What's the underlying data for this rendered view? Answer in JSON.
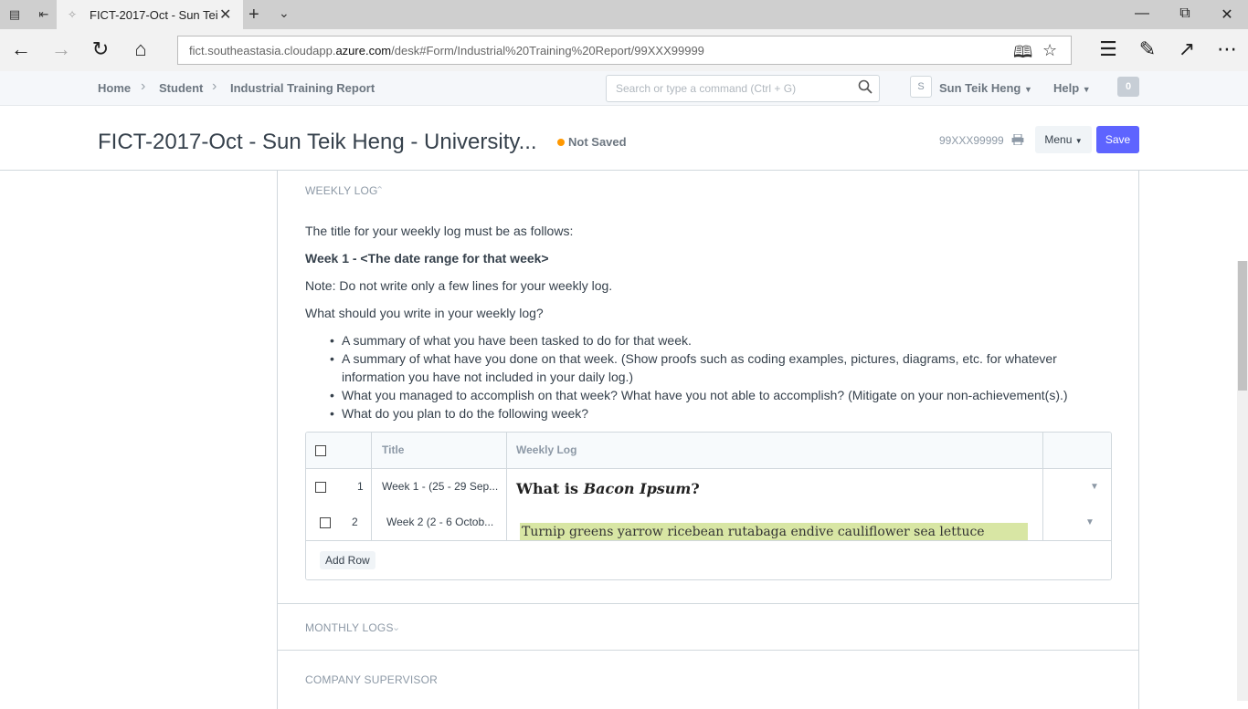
{
  "browser": {
    "tab_title": "FICT-2017-Oct - Sun Tei",
    "url_prefix": "fict.southeastasia.cloudapp.",
    "url_domain": "azure.com",
    "url_path": "/desk#Form/Industrial%20Training%20Report/99XXX99999"
  },
  "appbar": {
    "breadcrumbs": [
      "Home",
      "Student",
      "Industrial Training Report"
    ],
    "search_placeholder": "Search or type a command (Ctrl + G)",
    "avatar_initial": "S",
    "user_name": "Sun Teik Heng",
    "help_label": "Help",
    "notification_count": "0"
  },
  "page": {
    "title": "FICT-2017-Oct - Sun Teik Heng - University...",
    "status": "Not Saved",
    "doc_name": "99XXX99999",
    "menu_label": "Menu",
    "save_label": "Save"
  },
  "weekly_log": {
    "section_label": "WEEKLY LOG",
    "intro": "The title for your weekly log must be as follows:",
    "format": "Week 1 - <The date range for that week>",
    "note": "Note: Do not write only a few lines for your weekly log.",
    "question": "What should you write in your weekly log?",
    "bullets": [
      "A summary of what you have been tasked to do for that week.",
      "A summary of what have you done on that week. (Show proofs such as coding examples, pictures, diagrams, etc. for whatever information you have not included in your daily log.)",
      "What you managed to accomplish on that week? What have you not able to accomplish? (Mitigate on your non-achievement(s).)",
      "What do you plan to do the following week?"
    ],
    "table": {
      "columns": [
        "Title",
        "Weekly Log"
      ],
      "rows": [
        {
          "no": "1",
          "title": "Week 1 - (25 - 29 Sep..."
        },
        {
          "no": "2",
          "title": "Week 2 (2 - 6 Octob..."
        }
      ],
      "log_heading_prefix": "What is ",
      "log_heading_em": "Bacon Ipsum",
      "log_heading_suffix": "?",
      "log_highlight": "Turnip greens yarrow ricebean rutabaga endive cauliflower sea lettuce",
      "add_row_label": "Add Row"
    }
  },
  "sections": {
    "monthly_logs": "MONTHLY LOGS",
    "company_supervisor": "COMPANY SUPERVISOR"
  }
}
